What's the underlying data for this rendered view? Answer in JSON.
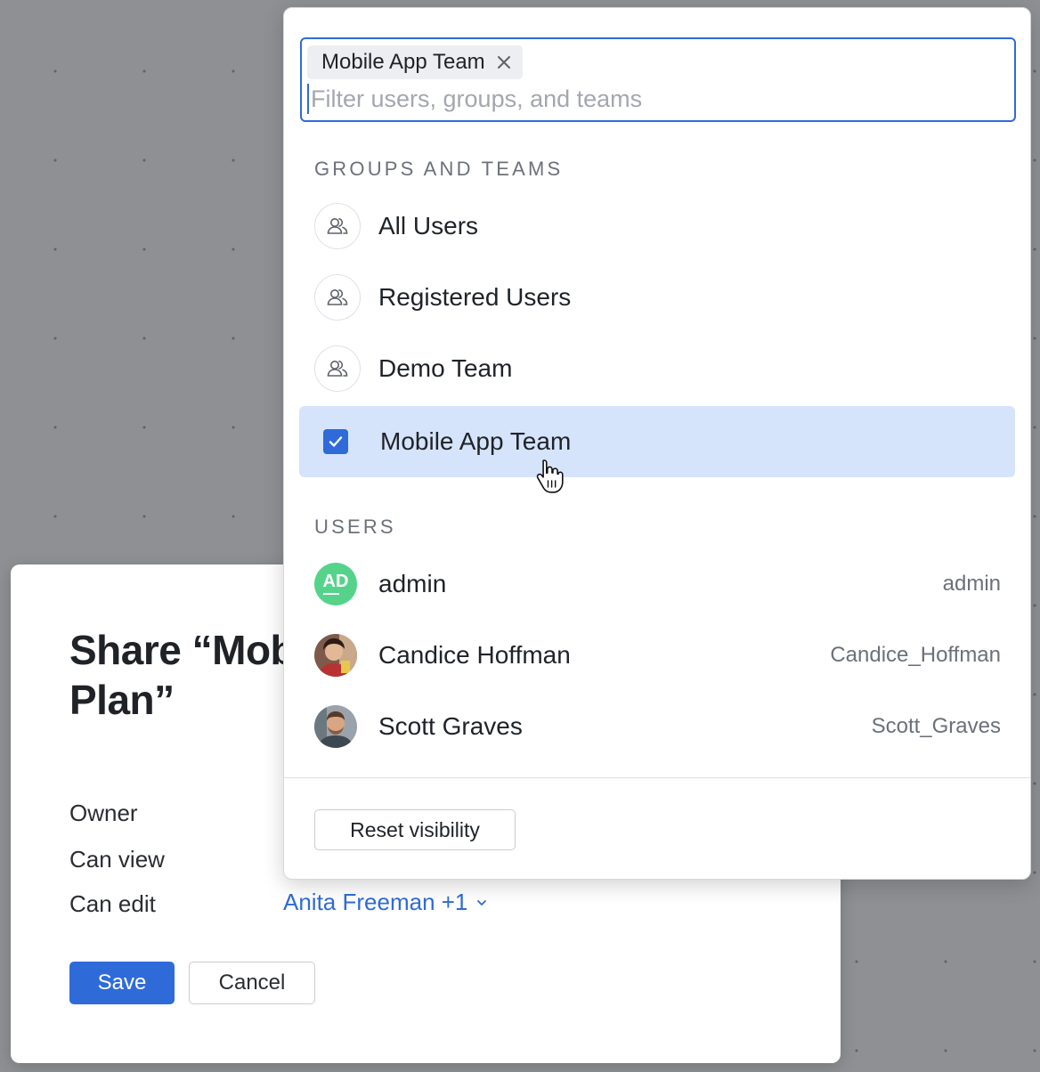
{
  "dialog": {
    "title": "Share “Mobile App Plan”",
    "title_line1": "Share “Mob",
    "title_line2": "Plan”",
    "permissions": {
      "owner_label": "Owner",
      "can_view_label": "Can view",
      "can_edit_label": "Can edit",
      "can_edit_value": "Anita Freeman +1"
    },
    "save_label": "Save",
    "cancel_label": "Cancel"
  },
  "popover": {
    "selected_chip": "Mobile App Team",
    "filter_placeholder": "Filter users, groups, and teams",
    "groups_header": "GROUPS AND TEAMS",
    "groups": [
      {
        "label": "All Users",
        "icon": "group-icon",
        "selected": false
      },
      {
        "label": "Registered Users",
        "icon": "group-icon",
        "selected": false
      },
      {
        "label": "Demo Team",
        "icon": "group-icon",
        "selected": false
      },
      {
        "label": "Mobile App Team",
        "icon": "checkbox-checked-icon",
        "selected": true
      }
    ],
    "users_header": "USERS",
    "users": [
      {
        "name": "admin",
        "handle": "admin",
        "avatar": "AD"
      },
      {
        "name": "Candice Hoffman",
        "handle": "Candice_Hoffman",
        "avatar": "photo"
      },
      {
        "name": "Scott Graves",
        "handle": "Scott_Graves",
        "avatar": "photo"
      }
    ],
    "reset_label": "Reset visibility"
  },
  "colors": {
    "accent": "#2f6bd8",
    "selected_row": "#d6e4fb",
    "avatar_admin": "#56d38b",
    "backdrop": "#8e9094"
  }
}
